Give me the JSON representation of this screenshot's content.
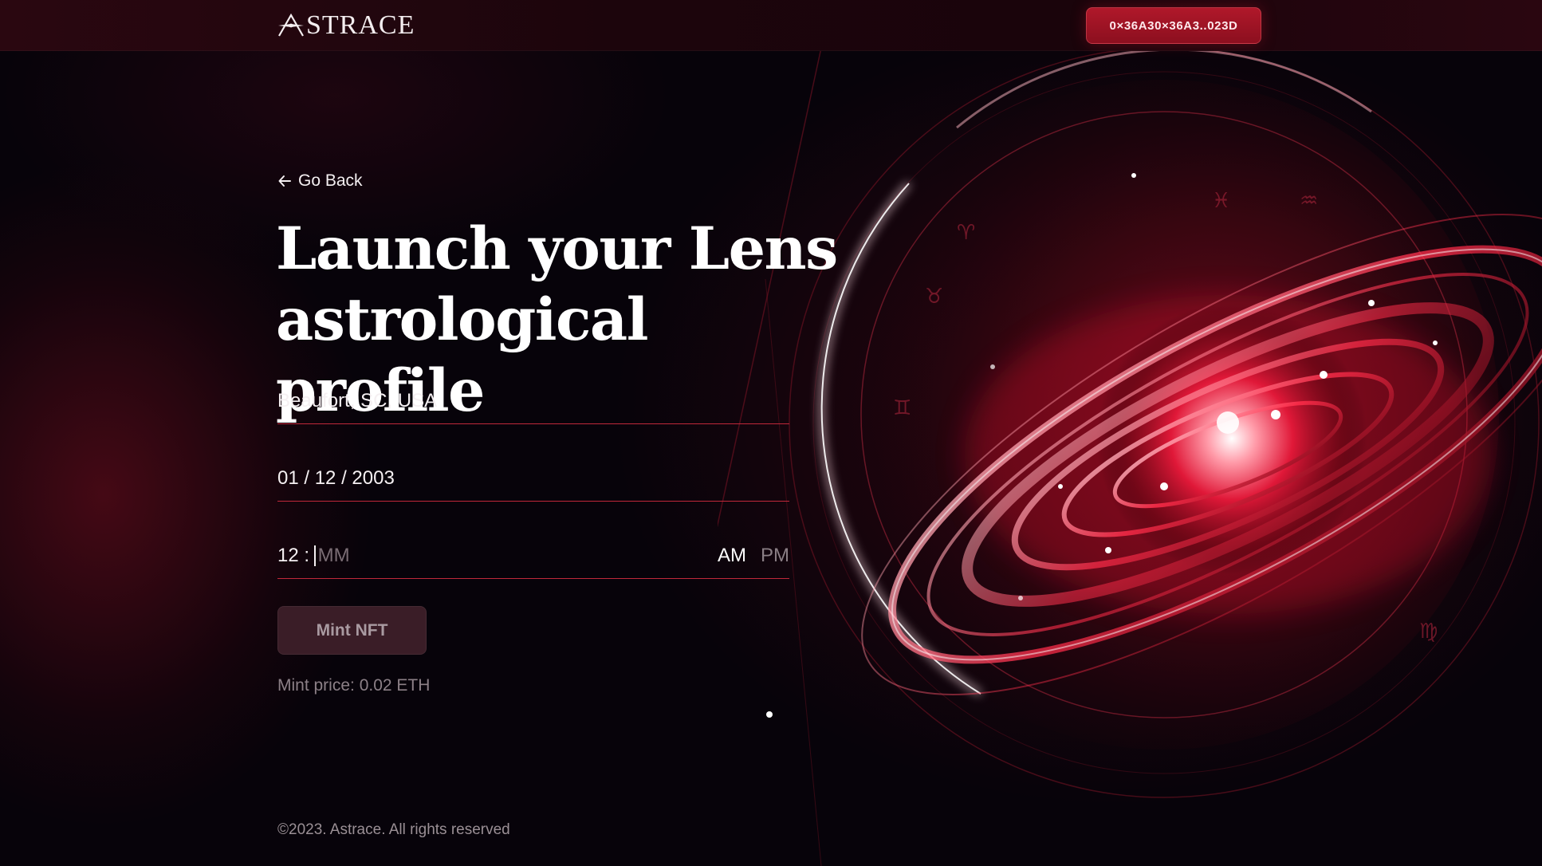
{
  "header": {
    "logo_text": "STRACE",
    "wallet_label": "0×36A30×36A3..023D"
  },
  "main": {
    "back_label": "Go Back",
    "headline_line1": "Launch your Lens",
    "headline_line2": "astrological profile",
    "location_value": "Beaufort, SC, USA",
    "date_value": "01 / 12 / 2003",
    "time_hour": "12 :",
    "time_minute_placeholder": "MM",
    "am_label": "AM",
    "pm_label": "PM",
    "mint_label": "Mint NFT",
    "mint_price": "Mint price: 0.02 ETH"
  },
  "footer": {
    "copyright": "©2023. Astrace. All rights reserved"
  },
  "icons": {
    "logo": "astrace-star-mark-icon",
    "back": "arrow-left-icon"
  },
  "colors": {
    "accent": "#b0182a",
    "underline": "#c0283a",
    "background": "#07030a"
  }
}
